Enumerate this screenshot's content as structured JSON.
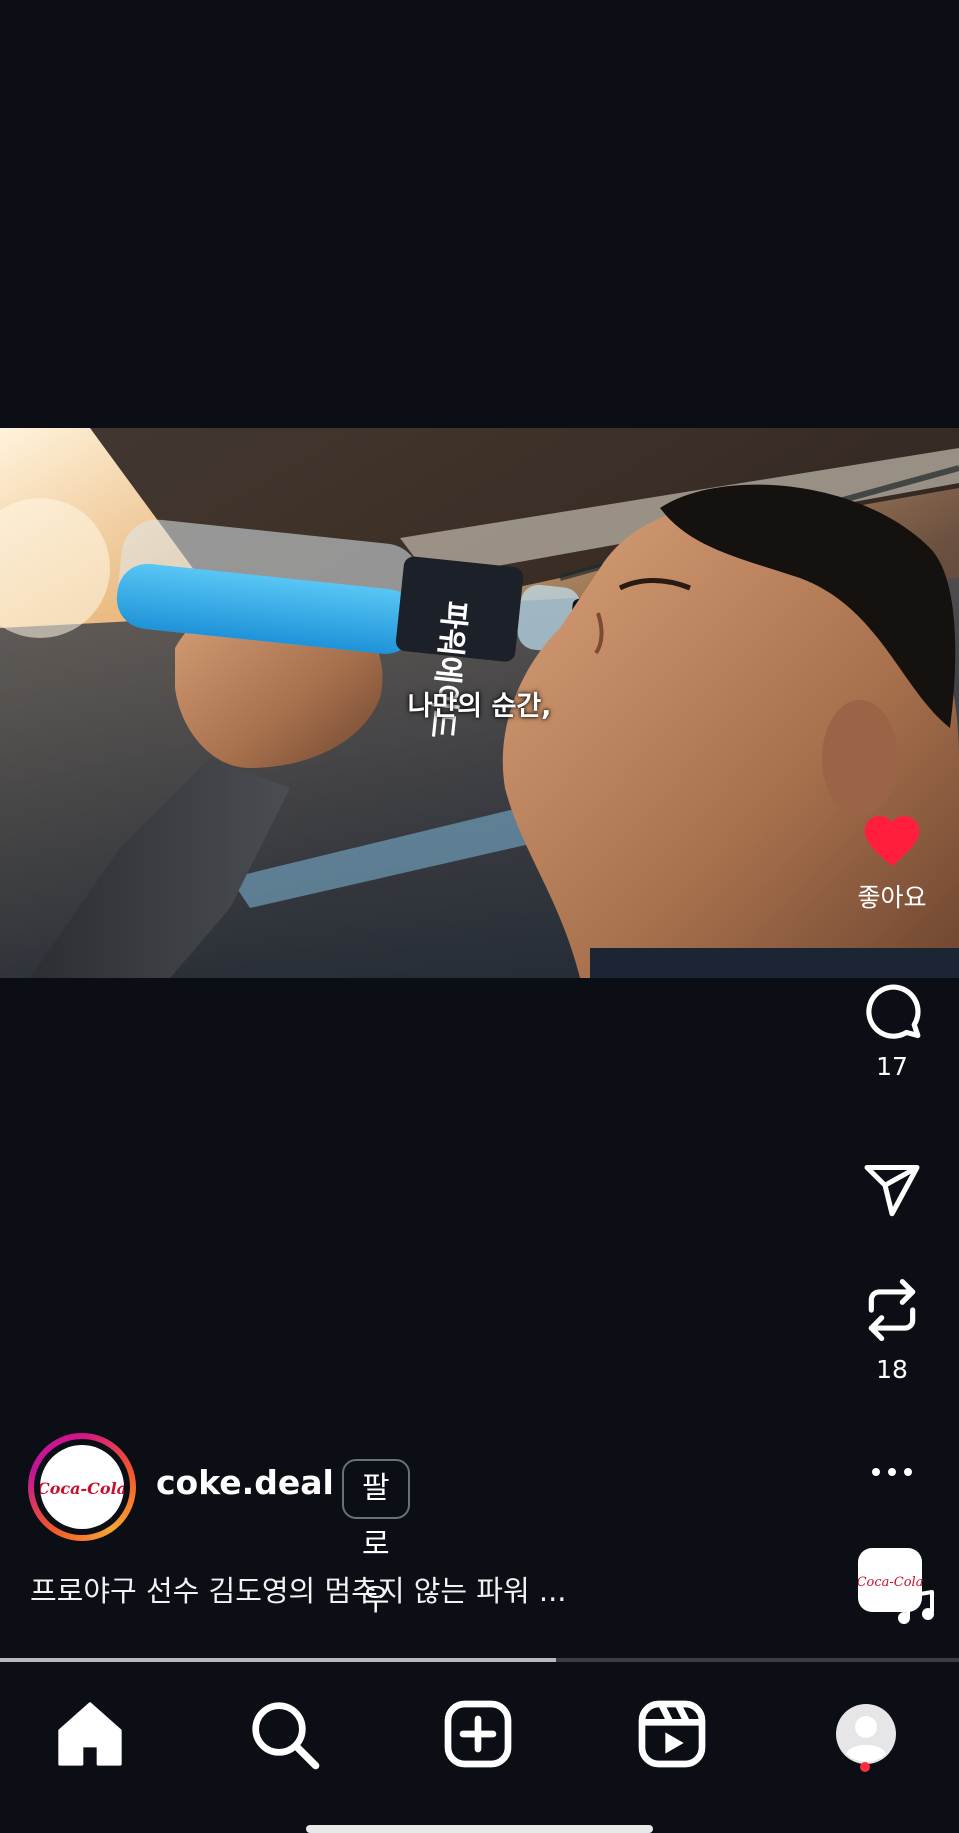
{
  "video": {
    "subtitle": "나만의 순간,",
    "bottle_label": "파워에이드",
    "progress": 0.58
  },
  "actions": {
    "like": {
      "icon": "heart-filled-icon",
      "label": "좋아요",
      "color": "#ff1f3d"
    },
    "comment": {
      "icon": "comment-icon",
      "count": "17"
    },
    "share": {
      "icon": "send-icon"
    },
    "repost": {
      "icon": "repost-icon",
      "count": "18"
    },
    "more": {
      "icon": "more-dots-icon"
    },
    "audio": {
      "icon": "music-note-icon",
      "logo_text": "Coca-Cola"
    }
  },
  "author": {
    "username": "coke.deal",
    "follow_label": "팔로우",
    "logo_text": "Coca-Cola"
  },
  "caption": "프로야구 선수 김도영의 멈추지 않는 파워 ...",
  "nav": {
    "items": [
      {
        "name": "home",
        "icon": "home-icon"
      },
      {
        "name": "search",
        "icon": "search-icon"
      },
      {
        "name": "create",
        "icon": "plus-square-icon"
      },
      {
        "name": "reels",
        "icon": "reels-icon"
      },
      {
        "name": "profile",
        "icon": "profile-avatar-icon"
      }
    ]
  },
  "colors": {
    "background": "#0b0e14",
    "like_red": "#ff1f3d",
    "notification_dot": "#ff2b40"
  }
}
